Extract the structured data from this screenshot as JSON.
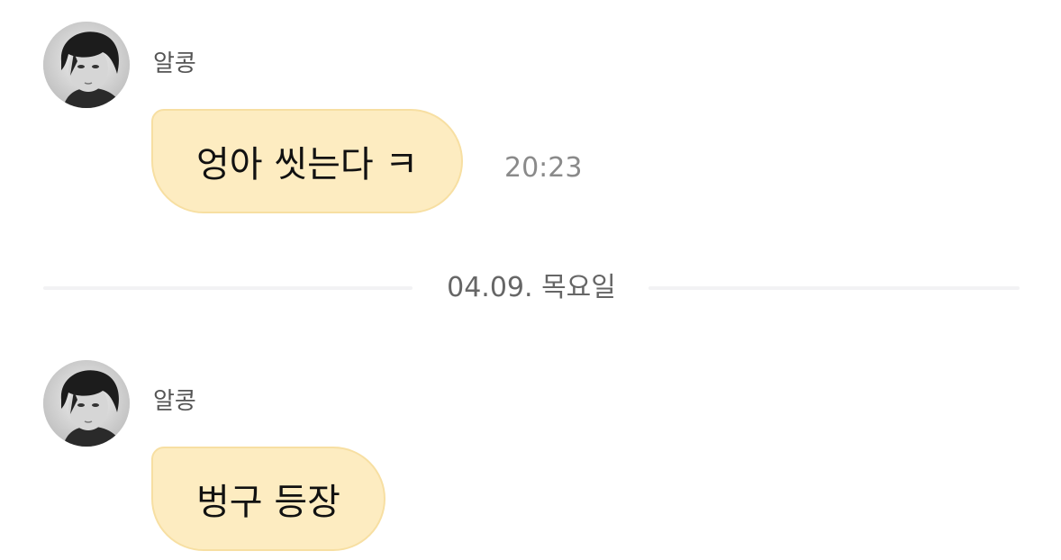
{
  "messages": [
    {
      "sender": "알콩",
      "text": "엉아 씻는다 ㅋ",
      "time": "20:23",
      "avatar_icon": "profile-photo"
    },
    {
      "sender": "알콩",
      "text": "벙구 등장",
      "time": "",
      "avatar_icon": "profile-photo"
    }
  ],
  "date_divider": {
    "label": "04.09. 목요일"
  },
  "colors": {
    "bubble_bg": "#fdecc1",
    "bubble_border": "#f7dfa2",
    "time_text": "#8a8a8a",
    "divider_line": "#f2f2f4"
  }
}
